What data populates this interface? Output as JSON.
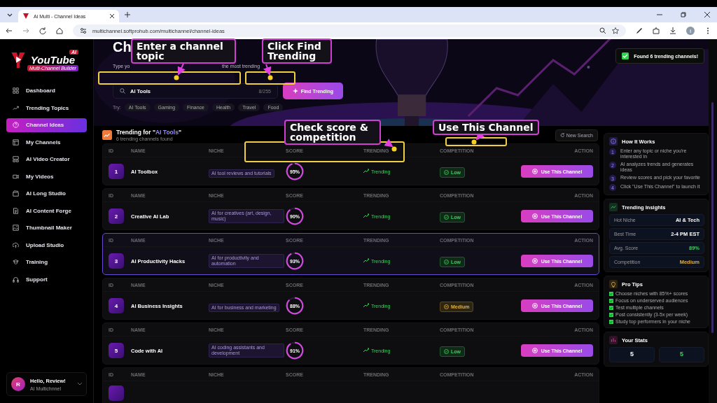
{
  "browser": {
    "tab_title": "Ai Multi - Channel Ideas",
    "url": "multichannel.softprohub.com/multichannel/channel-ideas",
    "avatar": "I"
  },
  "sidebar": {
    "logo": {
      "badge": "AI",
      "title": "YouTube",
      "tagline": "Multi-Channel Builder"
    },
    "items": [
      {
        "label": "Dashboard",
        "selected": false
      },
      {
        "label": "Trending Topics",
        "selected": false
      },
      {
        "label": "Channel Ideas",
        "selected": true
      },
      {
        "label": "My Channels",
        "selected": false
      },
      {
        "label": "AI Video Creator",
        "selected": false
      },
      {
        "label": "My Videos",
        "selected": false
      },
      {
        "label": "AI Long Studio",
        "selected": false
      },
      {
        "label": "AI Content Forge",
        "selected": false
      },
      {
        "label": "Thumbnail Maker",
        "selected": false
      },
      {
        "label": "Upload Studio",
        "selected": false
      },
      {
        "label": "Training",
        "selected": false
      },
      {
        "label": "Support",
        "selected": false
      }
    ],
    "user": {
      "initial": "R",
      "greeting": "Hello, Review!",
      "subtitle": "AI Multichnnel"
    }
  },
  "hero": {
    "title": "Ch",
    "subtitle_parts": [
      "Type yo",
      "the most trending"
    ],
    "search": {
      "value": "AI Tools",
      "counter": "8/255"
    },
    "button": "Find Trending",
    "try_label": "Try:",
    "chips": [
      "AI Tools",
      "Gaming",
      "Finance",
      "Health",
      "Travel",
      "Food"
    ]
  },
  "toast": "Found 6 trending channels!",
  "callouts": [
    {
      "text": "Enter a channel topic"
    },
    {
      "text": "Click Find Trending"
    },
    {
      "text": "Check score & competition"
    },
    {
      "text": "Use This Channel"
    }
  ],
  "results": {
    "title_prefix": "Trending for \"",
    "query": "AI Tools",
    "title_suffix": "\"",
    "subtitle": "6 trending channels found",
    "new_search": "New Search",
    "rows": [
      {
        "headers": [
          "ID",
          "NAME",
          "NICHE",
          "SCORE",
          "TRENDING",
          "COMPETITION",
          "ACTION"
        ],
        "id": "1",
        "name": "AI Toolbox",
        "niche": "AI tool reviews and tutorials",
        "score": "95%",
        "level": 0.95,
        "trending": "Trending",
        "competition": "Low",
        "kind": "low",
        "action": "Use This Channel",
        "selected": false
      },
      {
        "headers": [
          "ID",
          "NAME",
          "NICHE",
          "SCORE",
          "TRENDING",
          "COMPETITION",
          "ACTION"
        ],
        "id": "2",
        "name": "Creative AI Lab",
        "niche": "AI for creatives (art, design, music)",
        "score": "90%",
        "level": 0.9,
        "trending": "Trending",
        "competition": "Low",
        "kind": "low",
        "action": "Use This Channel",
        "selected": false
      },
      {
        "headers": [
          "ID",
          "NAME",
          "NICHE",
          "SCORE",
          "TRENDING",
          "COMPETITION",
          "ACTION"
        ],
        "id": "3",
        "name": "AI Productivity Hacks",
        "niche": "AI for productivity and automation",
        "score": "93%",
        "level": 0.93,
        "trending": "Trending",
        "competition": "Low",
        "kind": "low",
        "action": "Use This Channel",
        "selected": true
      },
      {
        "headers": [
          "ID",
          "NAME",
          "NICHE",
          "SCORE",
          "TRENDING",
          "COMPETITION",
          "ACTION"
        ],
        "id": "4",
        "name": "AI Business Insights",
        "niche": "AI for business and marketing",
        "score": "88%",
        "level": 0.88,
        "trending": "Trending",
        "competition": "Medium",
        "kind": "medium",
        "action": "Use This Channel",
        "selected": false
      },
      {
        "headers": [
          "ID",
          "NAME",
          "NICHE",
          "SCORE",
          "TRENDING",
          "COMPETITION",
          "ACTION"
        ],
        "id": "5",
        "name": "Code with AI",
        "niche": "AI coding assistants and development",
        "score": "91%",
        "level": 0.91,
        "trending": "Trending",
        "competition": "Low",
        "kind": "low",
        "action": "Use This Channel",
        "selected": false
      },
      {
        "headers": [
          "ID",
          "NAME",
          "NICHE",
          "SCORE",
          "TRENDING",
          "COMPETITION",
          "ACTION"
        ]
      }
    ]
  },
  "how_it_works": {
    "title": "How It Works",
    "steps": [
      {
        "num": "1",
        "text": "Enter any topic or niche you're interested in"
      },
      {
        "num": "2",
        "text": "AI analyzes trends and generates ideas"
      },
      {
        "num": "3",
        "text": "Review scores and pick your favorite"
      },
      {
        "num": "4",
        "text": "Click \"Use This Channel\" to launch it"
      }
    ]
  },
  "insights": {
    "title": "Trending Insights",
    "rows": [
      {
        "label": "Hot Niche",
        "value": "AI & Tech",
        "kind": "plain"
      },
      {
        "label": "Best Time",
        "value": "2-4 PM EST",
        "kind": "plain"
      },
      {
        "label": "Avg. Score",
        "value": "89%",
        "kind": "good"
      },
      {
        "label": "Competition",
        "value": "Medium",
        "kind": "warn"
      }
    ]
  },
  "pro_tips": {
    "title": "Pro Tips",
    "items": [
      "Choose niches with 85%+ scores",
      "Focus on underserved audiences",
      "Test multiple channels",
      "Post consistently (3-5x per week)",
      "Study top performers in your niche"
    ]
  },
  "stats": {
    "title": "Your Stats",
    "values": [
      {
        "value": "5",
        "kind": "plain"
      },
      {
        "value": "5",
        "kind": "good"
      }
    ]
  }
}
